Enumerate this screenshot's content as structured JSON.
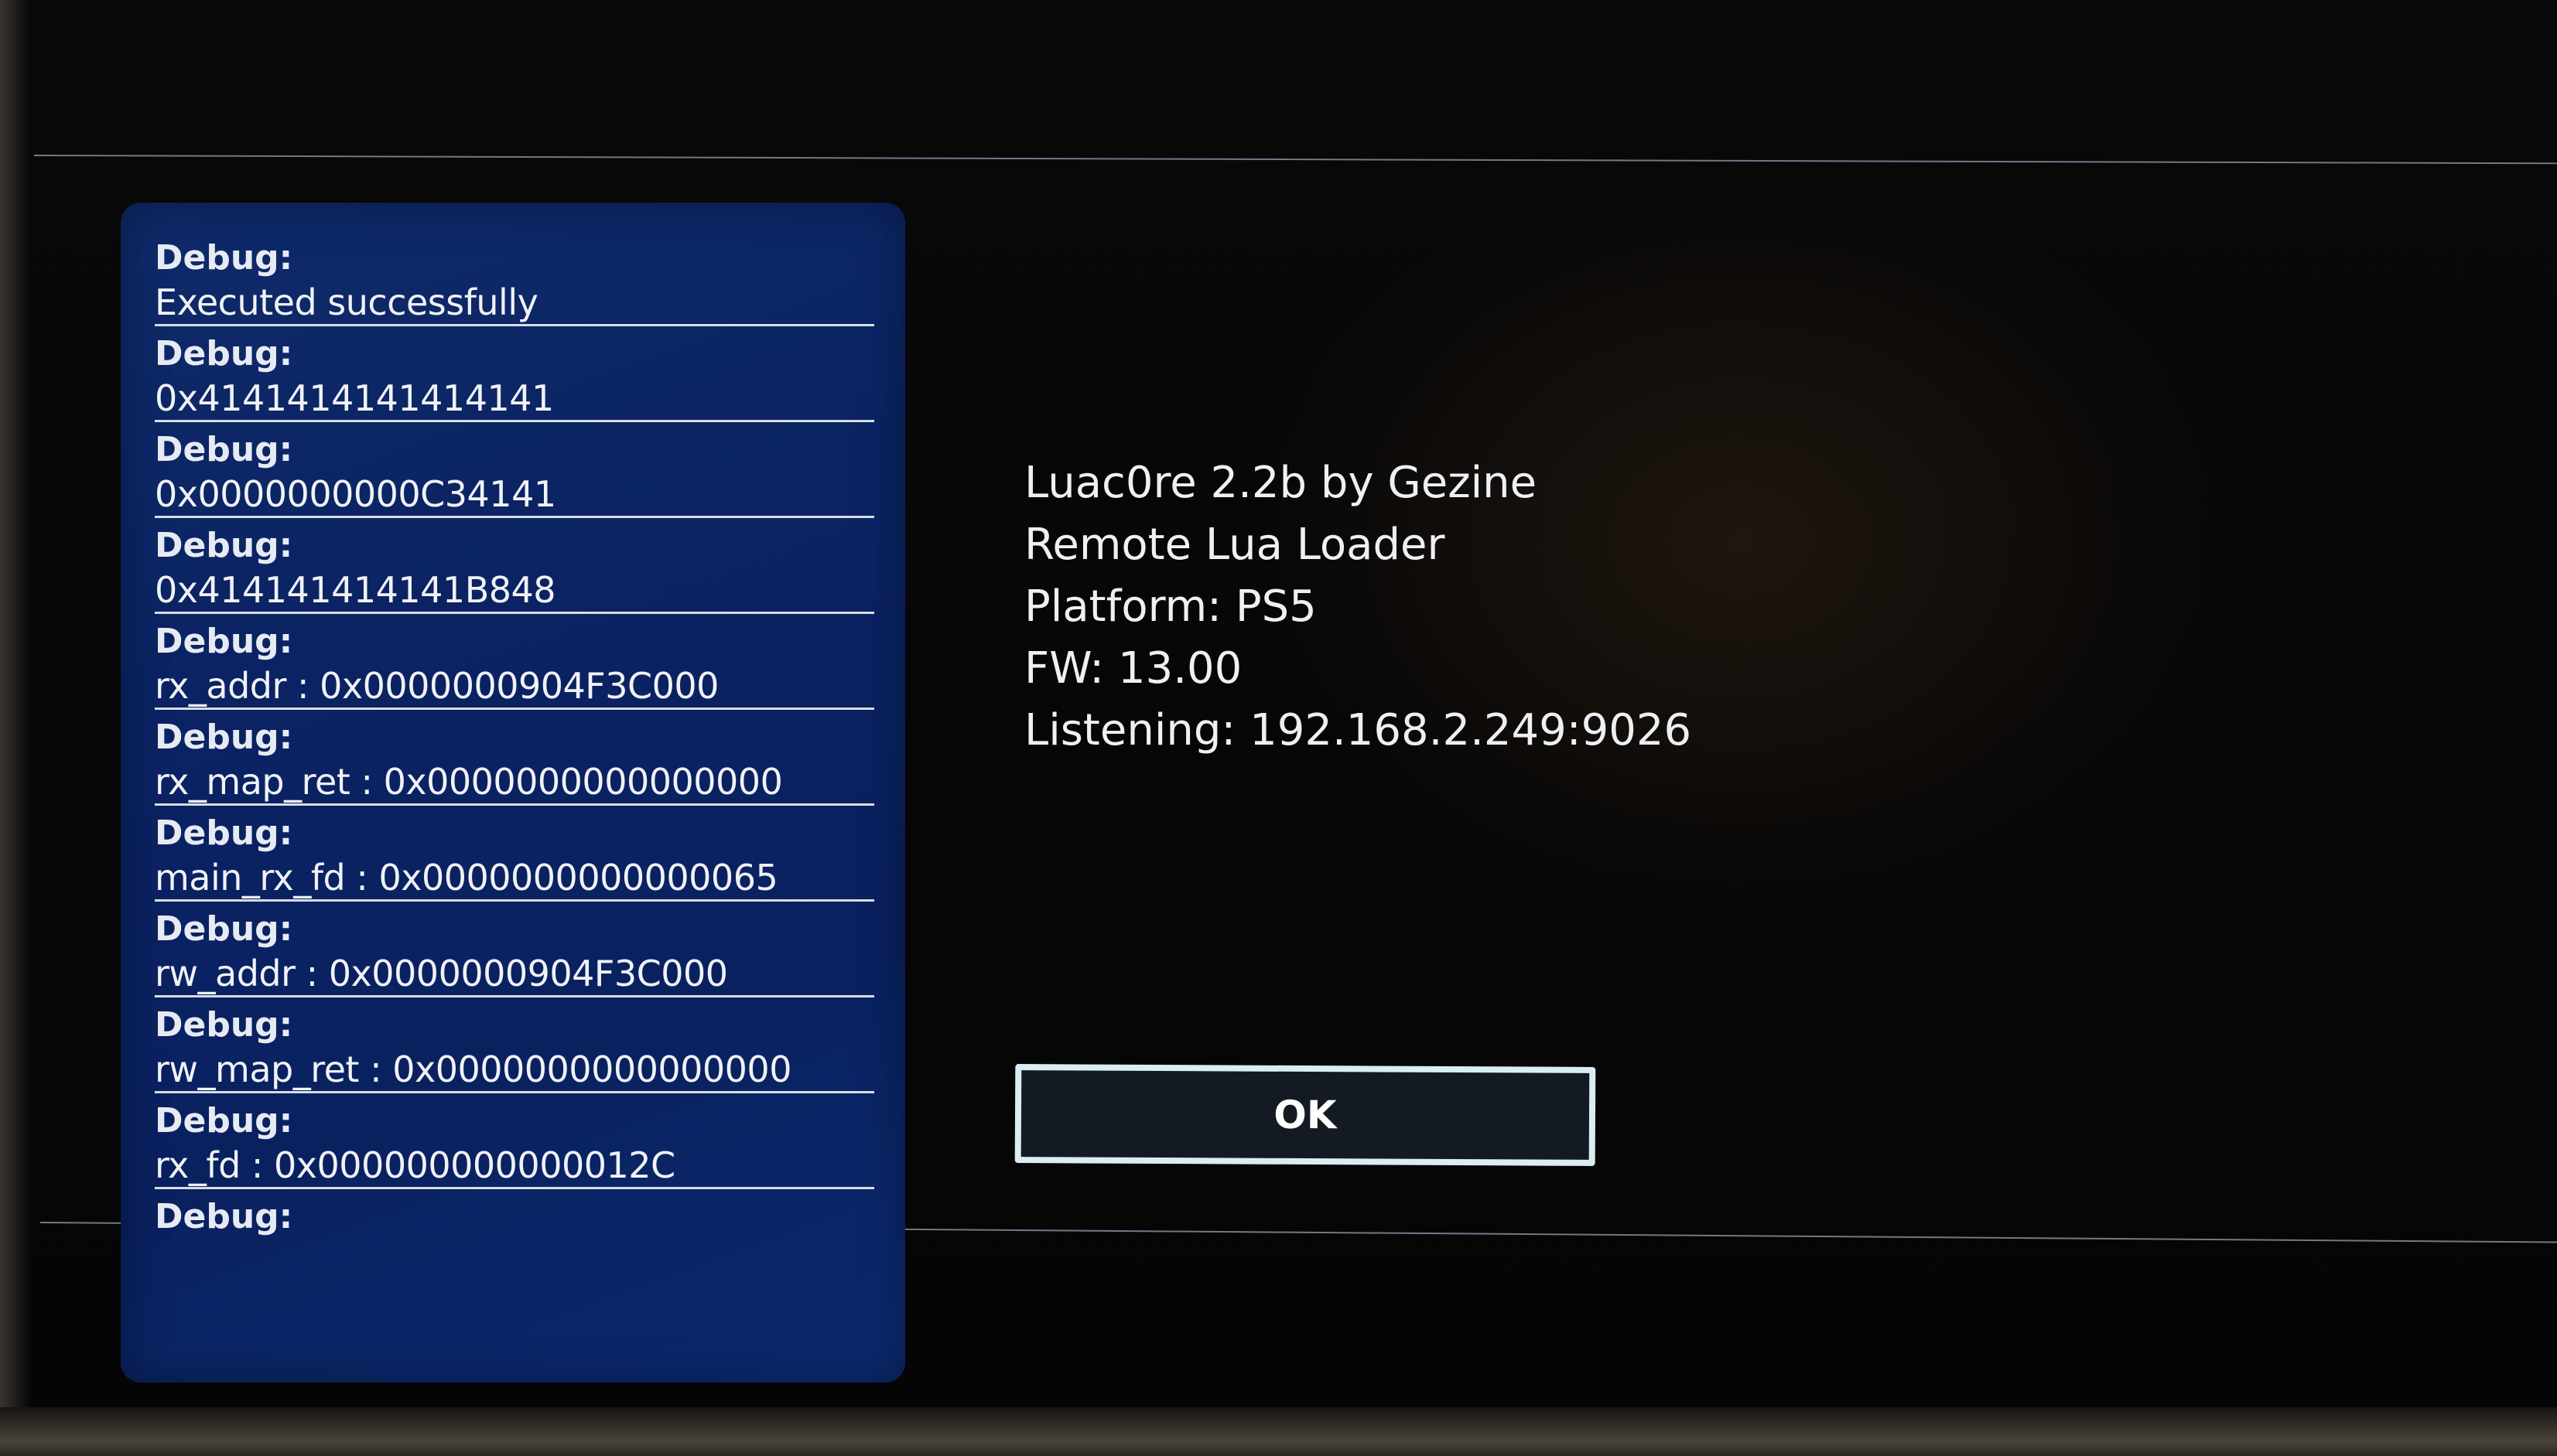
{
  "debug_log": {
    "entries": [
      {
        "label": "Debug:",
        "value": "Executed successfully"
      },
      {
        "label": "Debug:",
        "value": "0x4141414141414141"
      },
      {
        "label": "Debug:",
        "value": "0x0000000000C34141"
      },
      {
        "label": "Debug:",
        "value": "0x414141414141B848"
      },
      {
        "label": "Debug:",
        "value": "rx_addr : 0x0000000904F3C000"
      },
      {
        "label": "Debug:",
        "value": "rx_map_ret : 0x0000000000000000"
      },
      {
        "label": "Debug:",
        "value": "main_rx_fd : 0x0000000000000065"
      },
      {
        "label": "Debug:",
        "value": "rw_addr : 0x0000000904F3C000"
      },
      {
        "label": "Debug:",
        "value": "rw_map_ret : 0x0000000000000000"
      },
      {
        "label": "Debug:",
        "value": "rx_fd : 0x000000000000012C"
      },
      {
        "label": "Debug:",
        "value": ""
      }
    ]
  },
  "info": {
    "title": "Luac0re 2.2b by Gezine",
    "subtitle": "Remote Lua Loader",
    "platform": "Platform: PS5",
    "firmware": "FW: 13.00",
    "listening": "Listening: 192.168.2.249:9026"
  },
  "dialog": {
    "ok_label": "OK"
  },
  "colors": {
    "panel_blue": "#0b2363",
    "text": "#eef0f3",
    "button_border": "#d9edf2",
    "background": "#0a0908"
  }
}
